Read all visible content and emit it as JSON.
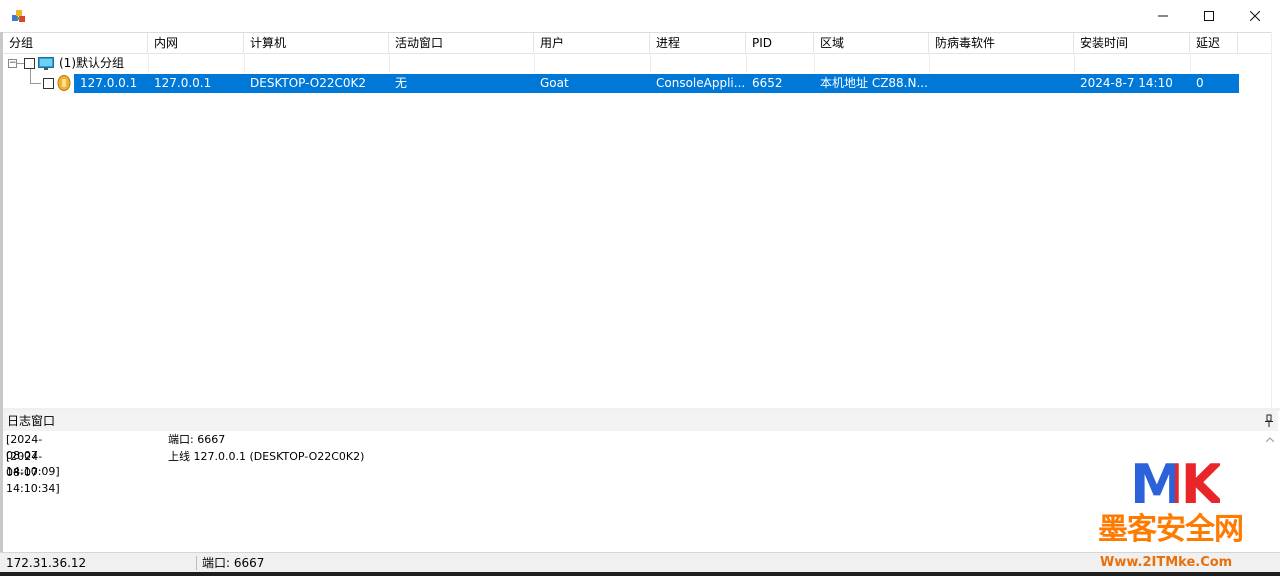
{
  "window": {
    "title": "",
    "controls": {
      "minimize": "minimize",
      "maximize": "maximize",
      "close": "close"
    }
  },
  "table": {
    "columns": [
      "分组",
      "内网",
      "计算机",
      "活动窗口",
      "用户",
      "进程",
      "PID",
      "区域",
      "防病毒软件",
      "安装时间",
      "延迟"
    ],
    "group": {
      "label": "(1)默认分组",
      "expander": "−"
    },
    "rows": [
      {
        "public_ip": "127.0.0.1",
        "internal_ip": "127.0.0.1",
        "computer": "DESKTOP-O22C0K2",
        "active_window": "无",
        "user": "Goat",
        "process": "ConsoleAppli...",
        "pid": "6652",
        "region": "本机地址  CZ88.N...",
        "antivirus": "",
        "install_time": "2024-8-7 14:10",
        "latency": "0"
      }
    ]
  },
  "log": {
    "title": "日志窗口",
    "entries": [
      {
        "time": "[2024-08-07 14:10:09]",
        "message": "端口: 6667"
      },
      {
        "time": "[2024-08-07 14:10:34]",
        "message": "上线 127.0.0.1 (DESKTOP-O22C0K2)"
      }
    ]
  },
  "status_bar": {
    "ip": "172.31.36.12",
    "port": "端口: 6667"
  },
  "watermark": {
    "mk": "MK",
    "name": "墨客安全网",
    "url": "Www.2ITMke.Com"
  },
  "colors": {
    "selection": "#0078d7",
    "watermark_m": "#2b62d9",
    "watermark_k": "#e8262a",
    "watermark_text": "#ff7a00"
  }
}
